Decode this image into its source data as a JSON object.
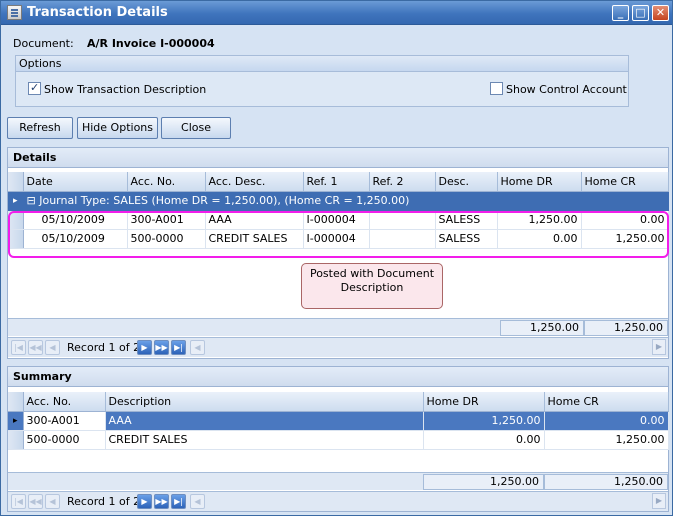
{
  "window": {
    "title": "Transaction Details",
    "minimize": "_",
    "maximize": "□",
    "close": "✕"
  },
  "document": {
    "label": "Document:",
    "value": "A/R Invoice I-000004"
  },
  "options": {
    "title": "Options",
    "show_description": {
      "label": "Show Transaction Description",
      "checked": true
    },
    "show_control": {
      "label": "Show Control Account",
      "checked": false
    }
  },
  "buttons": {
    "refresh": "Refresh",
    "hide_options": "Hide Options",
    "close": "Close"
  },
  "details": {
    "title": "Details",
    "columns": [
      "Date",
      "Acc. No.",
      "Acc. Desc.",
      "Ref. 1",
      "Ref. 2",
      "Desc.",
      "Home DR",
      "Home CR"
    ],
    "group": "Journal Type: SALES (Home DR = 1,250.00), (Home CR = 1,250.00)",
    "group_toggle": "⊟",
    "rows": [
      [
        "05/10/2009",
        "300-A001",
        "AAA",
        "I-000004",
        "",
        "SALESS",
        "1,250.00",
        "0.00"
      ],
      [
        "05/10/2009",
        "500-0000",
        "CREDIT SALES",
        "I-000004",
        "",
        "SALESS",
        "0.00",
        "1,250.00"
      ]
    ],
    "totals": {
      "dr": "1,250.00",
      "cr": "1,250.00"
    },
    "nav": {
      "record": "Record 1 of 2"
    }
  },
  "callout": {
    "line1": "Posted with Document",
    "line2": "Description"
  },
  "summary": {
    "title": "Summary",
    "columns": [
      "Acc. No.",
      "Description",
      "Home DR",
      "Home CR"
    ],
    "rows": [
      [
        "300-A001",
        "AAA",
        "1,250.00",
        "0.00"
      ],
      [
        "500-0000",
        "CREDIT SALES",
        "0.00",
        "1,250.00"
      ]
    ],
    "totals": {
      "dr": "1,250.00",
      "cr": "1,250.00"
    },
    "nav": {
      "record": "Record 1 of 2"
    }
  },
  "nav_glyphs": {
    "first": "|◀",
    "prev_page": "◀◀",
    "prev": "◀",
    "next": "▶",
    "next_page": "▶▶",
    "last": "▶|",
    "scroll_left": "◀",
    "scroll_right": "▶",
    "row_marker": "▸"
  }
}
